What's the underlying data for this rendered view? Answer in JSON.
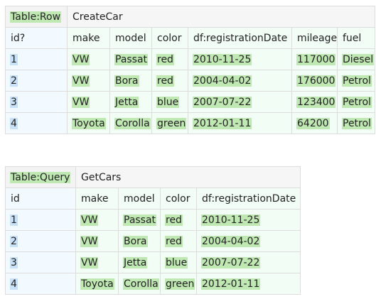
{
  "table_row": {
    "type_label": "Table:Row",
    "name": "CreateCar",
    "headers": [
      "id?",
      "make",
      "model",
      "color",
      "df:registrationDate",
      "mileage",
      "fuel"
    ],
    "rows": [
      [
        "1",
        "VW",
        "Passat",
        "red",
        "2010-11-25",
        "117000",
        "Diesel"
      ],
      [
        "2",
        "VW",
        "Bora",
        "red",
        "2004-04-02",
        "176000",
        "Petrol"
      ],
      [
        "3",
        "VW",
        "Jetta",
        "blue",
        "2007-07-22",
        "123400",
        "Petrol"
      ],
      [
        "4",
        "Toyota",
        "Corolla",
        "green",
        "2012-01-11",
        "64200",
        "Petrol"
      ]
    ]
  },
  "table_query": {
    "type_label": "Table:Query",
    "name": "GetCars",
    "headers": [
      "id",
      "make",
      "model",
      "color",
      "df:registrationDate"
    ],
    "rows": [
      [
        "1",
        "VW",
        "Passat",
        "red",
        "2010-11-25"
      ],
      [
        "2",
        "VW",
        "Bora",
        "red",
        "2004-04-02"
      ],
      [
        "3",
        "VW",
        "Jetta",
        "blue",
        "2007-07-22"
      ],
      [
        "4",
        "Toyota",
        "Corolla",
        "green",
        "2012-01-11"
      ]
    ]
  },
  "colors": {
    "pass_highlight": "#bfe8b3",
    "id_highlight": "#c9e1f6",
    "row_background": "#f2fdf6",
    "title_background": "#f3f3f3",
    "border": "#dddddd"
  }
}
